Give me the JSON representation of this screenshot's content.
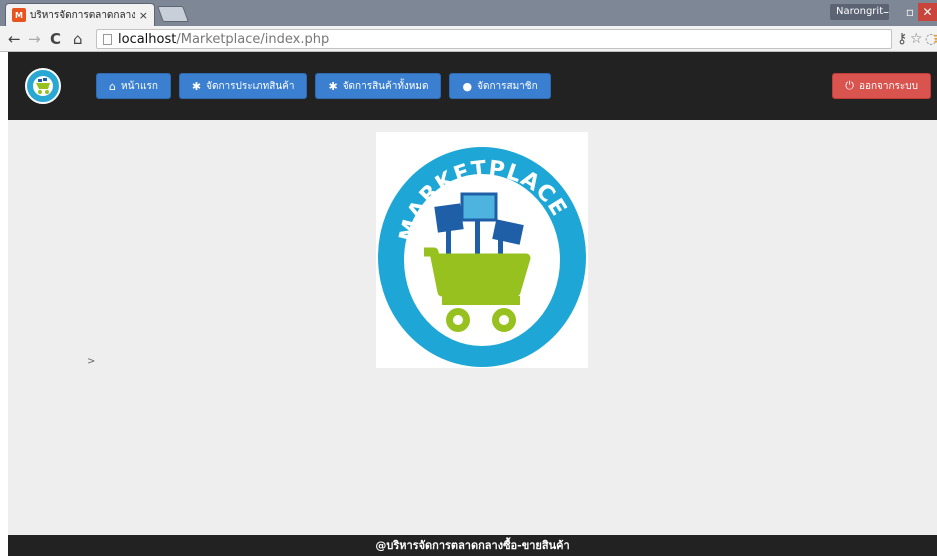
{
  "browser": {
    "tab_title": "บริหารจัดการตลาดกลางซื้อ-ข",
    "tab_close": "×",
    "user_name": "Narongrit",
    "url_host": "localhost",
    "url_path": "/Marketplace/index.php"
  },
  "navbar": {
    "buttons": [
      {
        "icon": "home-icon",
        "glyph": "⌂",
        "label": "หน้าแรก"
      },
      {
        "icon": "gear-icon",
        "glyph": "✱",
        "label": "จัดการประเภทสินค้า"
      },
      {
        "icon": "gear-icon",
        "glyph": "✱",
        "label": "จัดการสินค้าทั้งหมด"
      },
      {
        "icon": "user-icon",
        "glyph": "●",
        "label": "จัดการสมาชิก"
      }
    ],
    "logout": {
      "icon": "power-icon",
      "glyph": "⏻",
      "label": "ออกจากระบบ"
    }
  },
  "logo": {
    "text": "MARKETPLACE",
    "colors": {
      "ring": "#1ea7d6",
      "cart": "#97c11f",
      "signs": "#1f5fa8"
    }
  },
  "content": {
    "stray_text": ">"
  },
  "footer": {
    "text": "@บริหารจัดการตลาดกลางซื้อ-ขายสินค้า"
  },
  "colors": {
    "navbar_bg": "#222222",
    "primary_button": "#3a7fd0",
    "danger_button": "#d9534f",
    "content_bg": "#eeeeee"
  }
}
